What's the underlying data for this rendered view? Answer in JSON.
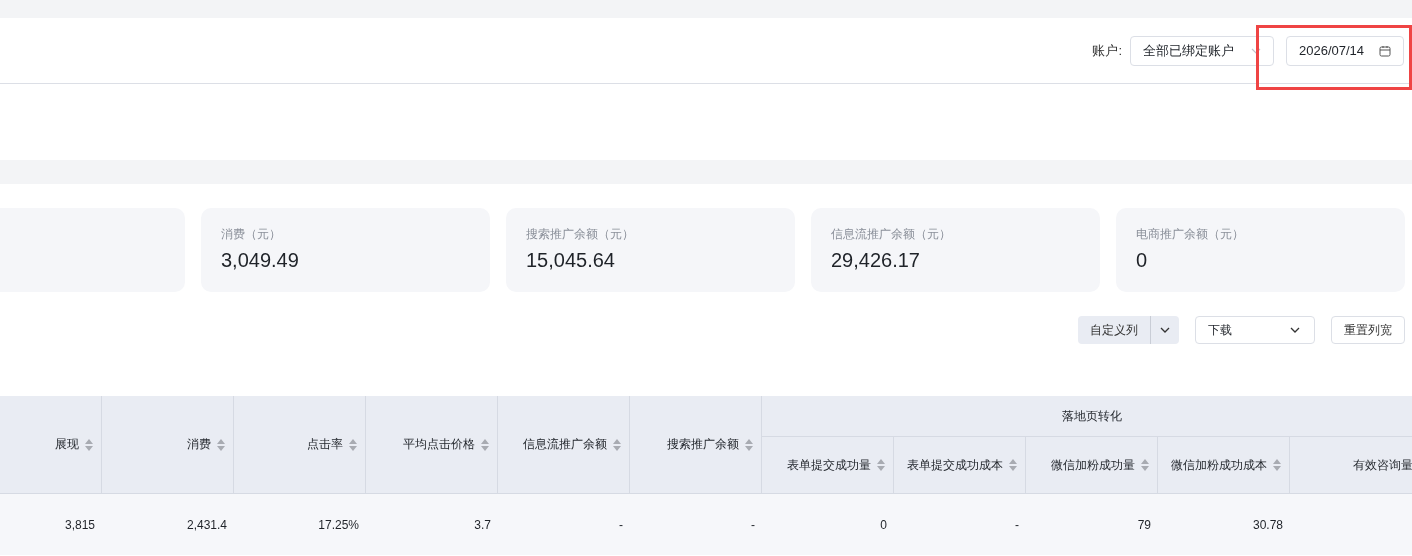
{
  "header": {
    "account_label": "账户:",
    "account_select": "全部已绑定账户",
    "date": "2026/07/14",
    "highlighted": true
  },
  "stat_cards": [
    {
      "label": "消费（元）",
      "value": "3,049.49"
    },
    {
      "label": "搜索推广余额（元）",
      "value": "15,045.64"
    },
    {
      "label": "信息流推广余额（元）",
      "value": "29,426.17"
    },
    {
      "label": "电商推广余额（元）",
      "value": "0"
    }
  ],
  "toolbar": {
    "custom_columns": "自定义列",
    "download": "下载",
    "reset_width": "重置列宽"
  },
  "table": {
    "columns": [
      {
        "label": "展现",
        "sortable": true
      },
      {
        "label": "消费",
        "sortable": true
      },
      {
        "label": "点击率",
        "sortable": true
      },
      {
        "label": "平均点击价格",
        "sortable": true
      },
      {
        "label": "信息流推广余额",
        "sortable": true
      },
      {
        "label": "搜索推广余额",
        "sortable": true
      }
    ],
    "group": {
      "label": "落地页转化",
      "columns": [
        {
          "label": "表单提交成功量",
          "sortable": true
        },
        {
          "label": "表单提交成功成本",
          "sortable": true
        },
        {
          "label": "微信加粉成功量",
          "sortable": true
        },
        {
          "label": "微信加粉成功成本",
          "sortable": true
        },
        {
          "label": "有效咨询量",
          "sortable": false
        }
      ]
    },
    "rows": [
      [
        "3,815",
        "2,431.4",
        "17.25%",
        "3.7",
        "-",
        "-",
        "0",
        "-",
        "79",
        "30.78"
      ]
    ]
  }
}
